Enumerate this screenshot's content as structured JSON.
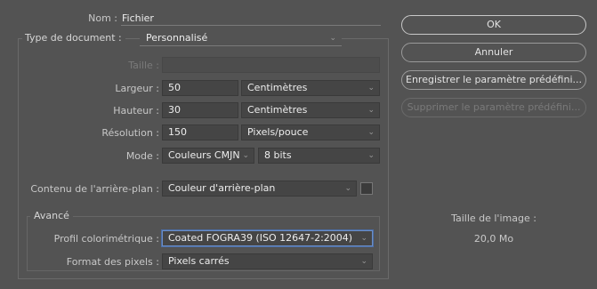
{
  "name_label": "Nom :",
  "name_value": "Fichier",
  "doc_type_label": "Type de document :",
  "doc_type_value": "Personnalisé",
  "size_label": "Taille :",
  "size_value": "",
  "width_label": "Largeur :",
  "width_value": "50",
  "width_unit": "Centimètres",
  "height_label": "Hauteur :",
  "height_value": "30",
  "height_unit": "Centimètres",
  "resolution_label": "Résolution :",
  "resolution_value": "150",
  "resolution_unit": "Pixels/pouce",
  "mode_label": "Mode :",
  "mode_value": "Couleurs CMJN",
  "bits_value": "8 bits",
  "background_label": "Contenu de l'arrière-plan :",
  "background_value": "Couleur d'arrière-plan",
  "background_color": "#3b3b3b",
  "advanced_label": "Avancé",
  "profile_label": "Profil colorimétrique :",
  "profile_value": "Coated FOGRA39 (ISO 12647-2:2004)",
  "pixel_format_label": "Format des pixels :",
  "pixel_format_value": "Pixels carrés",
  "buttons": {
    "ok": "OK",
    "cancel": "Annuler",
    "save_preset": "Enregistrer le paramètre prédéfini...",
    "delete_preset": "Supprimer le paramètre prédéfini..."
  },
  "image_size_label": "Taille de l'image :",
  "image_size_value": "20,0 Mo",
  "chevron": "⌄"
}
